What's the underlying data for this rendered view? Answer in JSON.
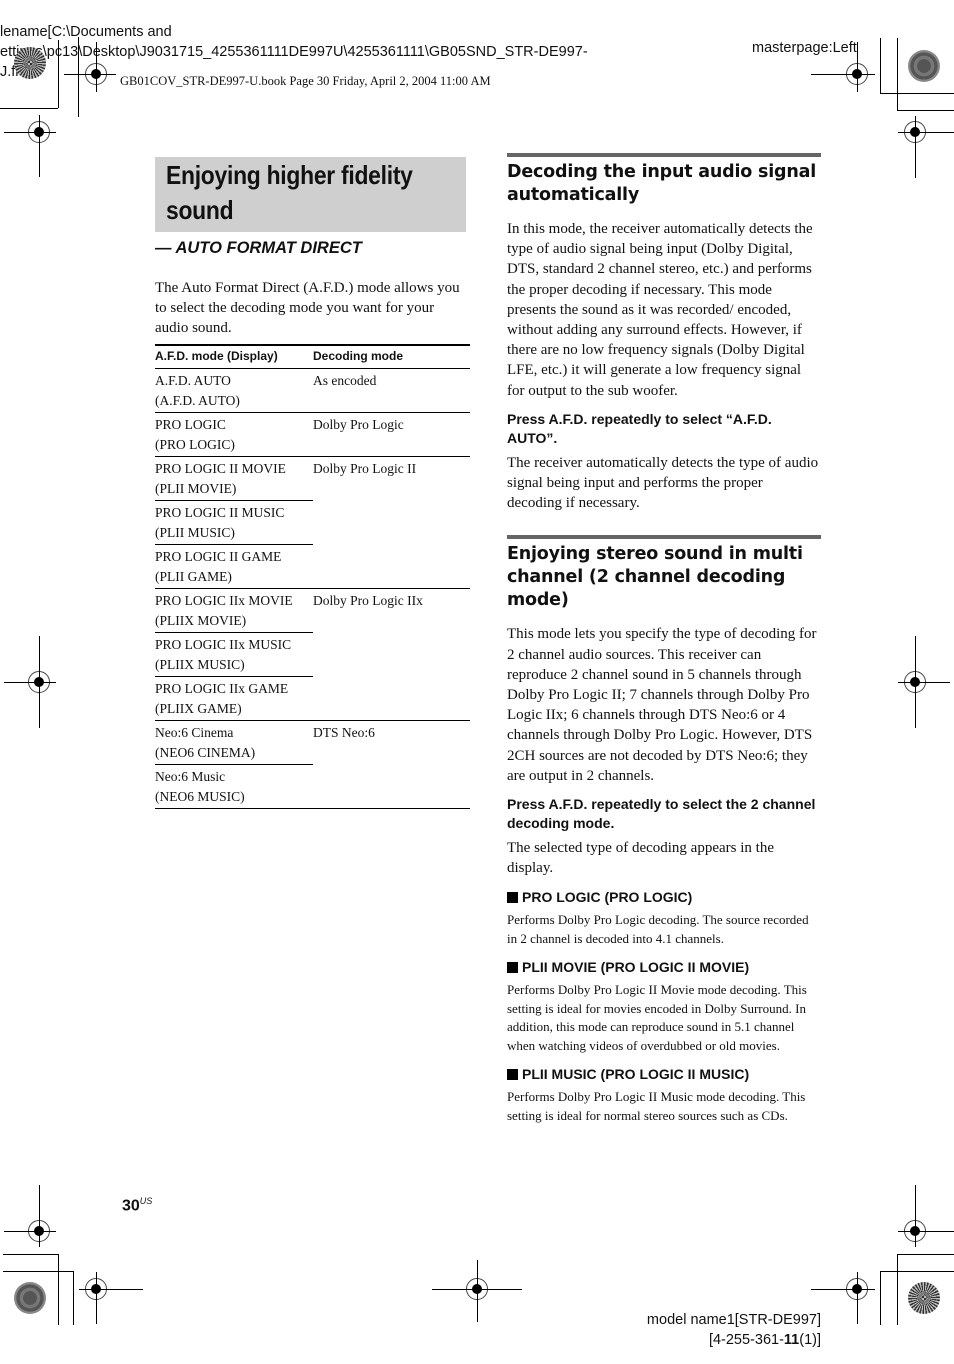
{
  "header": {
    "filename_lines": [
      "lename[C:\\Documents and",
      "ettings\\pc13\\Desktop\\J9031715_4255361111DE997U\\4255361111\\GB05SND_STR-DE997-",
      "J.fr"
    ],
    "book_line": "GB01COV_STR-DE997-U.book  Page 30  Friday, April 2, 2004  11:00 AM",
    "masterpage": "masterpage:Left"
  },
  "left": {
    "title_line1": "Enjoying higher fidelity",
    "title_line2": "sound",
    "subtitle": "— AUTO FORMAT DIRECT",
    "intro": "The Auto Format Direct (A.F.D.) mode allows you to select the decoding mode you want for your audio sound.",
    "table": {
      "headers": [
        "A.F.D. mode (Display)",
        "Decoding mode"
      ],
      "groups": [
        {
          "decoding": "As encoded",
          "modes": [
            [
              "A.F.D. AUTO",
              "(A.F.D. AUTO)"
            ]
          ]
        },
        {
          "decoding": "Dolby Pro Logic",
          "modes": [
            [
              "PRO LOGIC",
              "(PRO LOGIC)"
            ]
          ]
        },
        {
          "decoding": "Dolby Pro Logic II",
          "modes": [
            [
              "PRO LOGIC II MOVIE",
              "(PLII MOVIE)"
            ],
            [
              "PRO LOGIC II MUSIC",
              "(PLII MUSIC)"
            ],
            [
              "PRO LOGIC II GAME",
              "(PLII GAME)"
            ]
          ]
        },
        {
          "decoding": "Dolby Pro Logic IIx",
          "modes": [
            [
              "PRO LOGIC IIx MOVIE",
              "(PLIIX MOVIE)"
            ],
            [
              "PRO LOGIC IIx MUSIC",
              "(PLIIX MUSIC)"
            ],
            [
              "PRO LOGIC IIx GAME",
              "(PLIIX GAME)"
            ]
          ]
        },
        {
          "decoding": "DTS Neo:6",
          "modes": [
            [
              "Neo:6 Cinema",
              "(NEO6 CINEMA)"
            ],
            [
              "Neo:6 Music",
              "(NEO6 MUSIC)"
            ]
          ]
        }
      ]
    }
  },
  "right": {
    "sec1_title": "Decoding the input audio signal automatically",
    "sec1_body": "In this mode, the receiver automatically detects the type of audio signal being input (Dolby Digital, DTS, standard 2 channel stereo, etc.) and performs the proper decoding if necessary. This mode presents the sound as it was recorded/ encoded, without adding any surround effects. However, if there are no low frequency signals (Dolby Digital LFE, etc.) it will generate a low frequency signal for output to the sub woofer.",
    "sec1_instr": "Press A.F.D. repeatedly to select “A.F.D. AUTO”.",
    "sec1_result": "The receiver automatically detects the type of audio signal being input and performs the proper decoding if necessary.",
    "sec2_title": "Enjoying stereo sound in multi channel (2 channel decoding mode)",
    "sec2_body": "This mode lets you specify the type of decoding for 2 channel audio sources. This receiver can reproduce 2 channel sound in 5 channels through Dolby Pro Logic II; 7 channels through Dolby Pro Logic IIx; 6 channels through DTS Neo:6 or 4 channels through Dolby Pro Logic. However, DTS 2CH sources are not decoded by DTS Neo:6; they are output in 2 channels.",
    "sec2_instr": "Press A.F.D. repeatedly to select the 2 channel decoding mode.",
    "sec2_result": "The selected type of decoding appears in the display.",
    "modes": [
      {
        "title": "PRO LOGIC (PRO LOGIC)",
        "desc": "Performs Dolby Pro Logic decoding. The source recorded in 2 channel is decoded into 4.1 channels."
      },
      {
        "title": "PLII MOVIE (PRO LOGIC II MOVIE)",
        "desc": "Performs Dolby Pro Logic II Movie mode decoding. This setting is ideal for movies encoded in Dolby Surround. In addition, this mode can reproduce sound in 5.1 channel when watching videos of overdubbed or old movies."
      },
      {
        "title": "PLII MUSIC (PRO LOGIC II MUSIC)",
        "desc": "Performs Dolby Pro Logic II Music mode decoding. This setting is ideal for normal stereo sources such as CDs."
      }
    ]
  },
  "footer": {
    "page_number": "30",
    "page_suffix": "US",
    "model_line1": "model name1[STR-DE997]",
    "model_line2_pre": "[4-255-361-",
    "model_line2_bold": "11",
    "model_line2_post": "(1)]"
  }
}
